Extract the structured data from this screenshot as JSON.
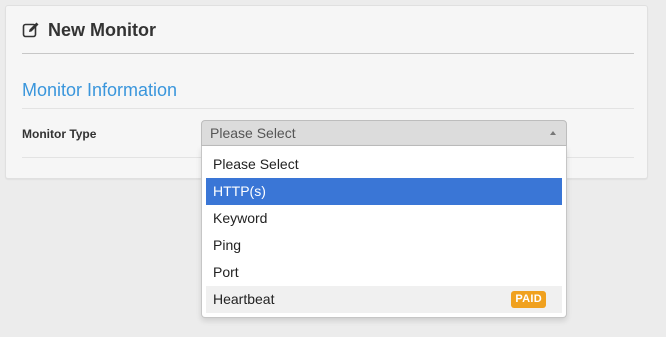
{
  "card": {
    "title": "New Monitor",
    "icon": "edit-icon"
  },
  "section": {
    "title": "Monitor Information"
  },
  "form": {
    "monitor_type_label": "Monitor Type",
    "monitor_type_value": "Please Select"
  },
  "dropdown": {
    "options": [
      {
        "label": "Please Select"
      },
      {
        "label": "HTTP(s)",
        "highlighted": true
      },
      {
        "label": "Keyword"
      },
      {
        "label": "Ping"
      },
      {
        "label": "Port"
      },
      {
        "label": "Heartbeat",
        "badge": "PAID"
      }
    ]
  },
  "colors": {
    "accent": "#3a96dc",
    "highlight": "#3a76d6",
    "badge": "#f0a11f"
  }
}
